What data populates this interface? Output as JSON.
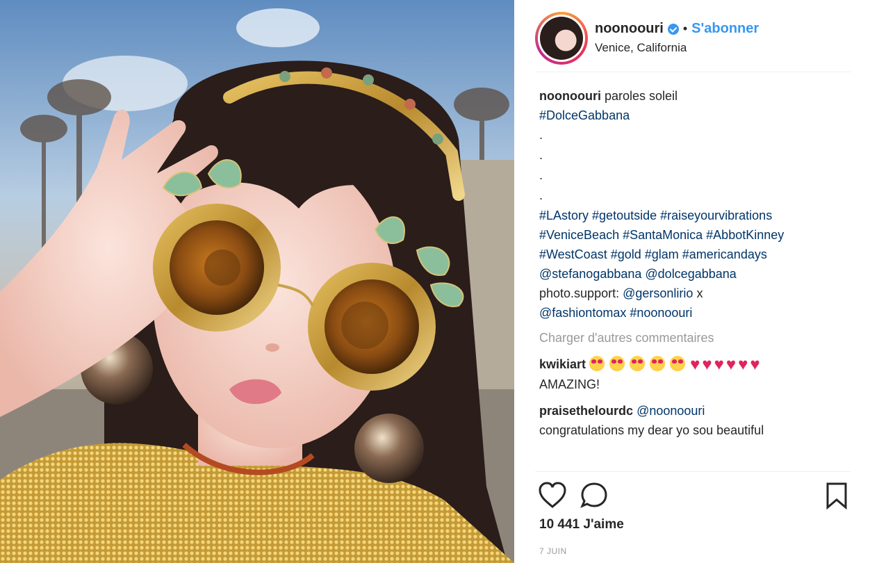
{
  "post": {
    "username": "noonoouri",
    "follow_label": "S'abonner",
    "location": "Venice, California"
  },
  "caption": {
    "user": "noonoouri",
    "text": "paroles soleil",
    "tag_line": "#DolceGabbana",
    "dots": [
      ".",
      ".",
      ".",
      "."
    ],
    "hashtags_1": "#LAstory #getoutside #raiseyourvibrations",
    "hashtags_2": "#VeniceBeach #SantaMonica #AbbotKinney",
    "hashtags_3": "#WestCoast #gold #glam #americandays",
    "mentions": "@stefanogabbana @dolcegabbana",
    "photo_support": "photo.support:",
    "photo_support_user": "@gersonlirio",
    "photo_support_x": "x",
    "final_line": "@fashiontomax #noonoouri"
  },
  "load_more_label": "Charger d'autres commentaires",
  "comments": [
    {
      "user": "kwikiart",
      "emoji_faces": 5,
      "emoji_hearts": 6,
      "text": "AMAZING!"
    },
    {
      "user": "praisethelourdc",
      "mention": "@noonoouri",
      "text": "congratulations my dear yo sou beautiful"
    }
  ],
  "likes": "10 441 J'aime",
  "date": "7 JUIN",
  "icons": [
    "heart-icon",
    "comment-icon",
    "bookmark-icon",
    "verified-badge-icon"
  ],
  "colors": {
    "link": "#3897f0",
    "hashtag": "#003569",
    "muted": "#999999",
    "avatar_ring": "#e8345a"
  }
}
